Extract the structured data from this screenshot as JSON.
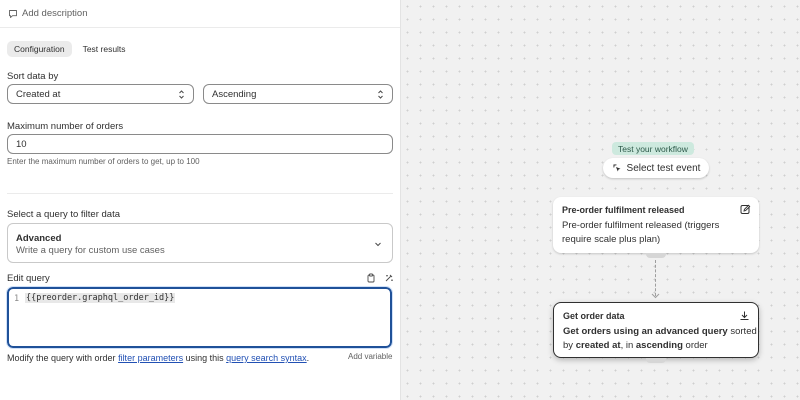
{
  "header": {
    "add_description": "Add description"
  },
  "tabs": [
    {
      "label": "Configuration",
      "active": true
    },
    {
      "label": "Test results",
      "active": false
    }
  ],
  "sort": {
    "label": "Sort data by",
    "field_value": "Created at",
    "order_value": "Ascending"
  },
  "max_orders": {
    "label": "Maximum number of orders",
    "value": "10",
    "help": "Enter the maximum number of orders to get, up to 100"
  },
  "query_filter": {
    "label": "Select a query to filter data",
    "title": "Advanced",
    "subtitle": "Write a query for custom use cases"
  },
  "edit_query": {
    "label": "Edit query",
    "line_number": "1",
    "code": "{{preorder.graphql_order_id}}"
  },
  "footer": {
    "text_1": "Modify the query with order ",
    "link_1": "filter parameters",
    "text_2": " using this ",
    "link_2": "query search syntax",
    "text_3": ".",
    "add_variable": "Add variable"
  },
  "canvas": {
    "test_badge": "Test your workflow",
    "select_event": "Select test event",
    "node1": {
      "title": "Pre-order fulfilment released",
      "body_line1": "Pre-order fulfilment released (triggers",
      "body_line2": "require scale plus plan)"
    },
    "node2": {
      "title": "Get order data",
      "b1": "Get orders using an advanced query",
      "t1": " sorted",
      "t2": "by ",
      "b2": "created at",
      "t3": ", in ",
      "b3": "ascending",
      "t4": " order"
    }
  },
  "colors": {
    "accent_blue": "#1f5199",
    "badge_green": "#cde9de",
    "link_blue": "#2150b4"
  }
}
